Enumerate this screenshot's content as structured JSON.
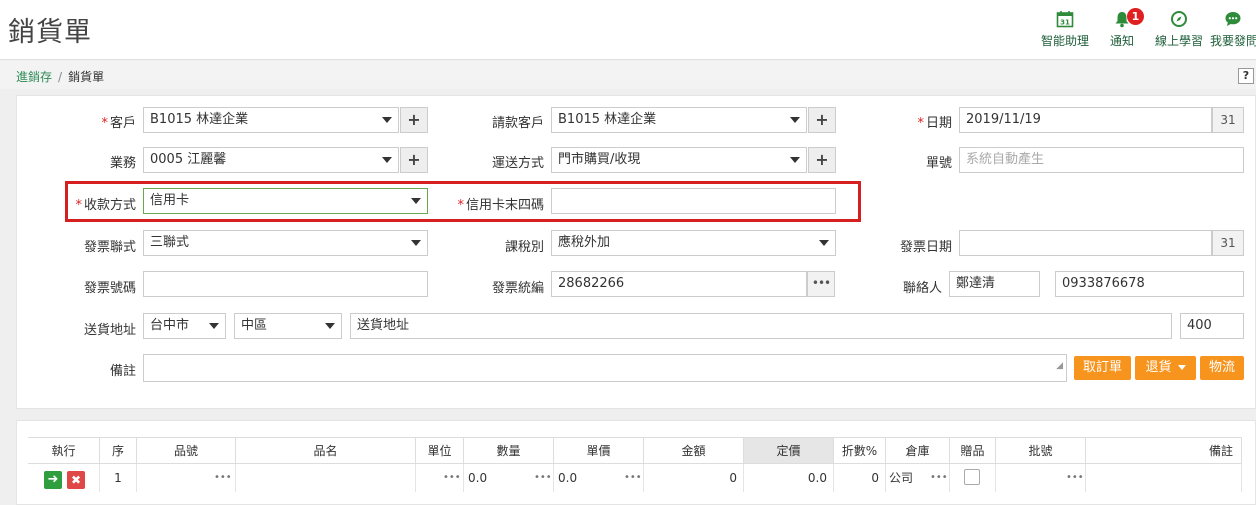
{
  "page": {
    "title": "銷貨單"
  },
  "toolbar": {
    "items": [
      {
        "label": "智能助理",
        "icon": "calendar-31-icon",
        "glyph": "31"
      },
      {
        "label": "通知",
        "icon": "bell-icon",
        "glyph": "🔔",
        "badge": "1"
      },
      {
        "label": "線上學習",
        "icon": "compass-icon",
        "glyph": "⊘"
      },
      {
        "label": "我要發問",
        "icon": "chat-icon",
        "glyph": "💬"
      }
    ]
  },
  "breadcrumb": {
    "parent": "進銷存",
    "separator": "/",
    "current": "銷貨單",
    "help": "?"
  },
  "form": {
    "customer": {
      "label": "客戶",
      "value": "B1015 林達企業"
    },
    "billing_customer": {
      "label": "請款客戶",
      "value": "B1015 林達企業"
    },
    "date": {
      "label": "日期",
      "value": "2019/11/19"
    },
    "salesperson": {
      "label": "業務",
      "value": "0005 江麗馨"
    },
    "delivery_method": {
      "label": "運送方式",
      "value": "門市購買/收現"
    },
    "doc_no": {
      "label": "單號",
      "placeholder": "系統自動產生"
    },
    "payment_method": {
      "label": "收款方式",
      "value": "信用卡"
    },
    "card_last4": {
      "label": "信用卡末四碼",
      "value": ""
    },
    "invoice_copies": {
      "label": "發票聯式",
      "value": "三聯式"
    },
    "tax_type": {
      "label": "課稅別",
      "value": "應稅外加"
    },
    "invoice_date": {
      "label": "發票日期",
      "value": ""
    },
    "invoice_no": {
      "label": "發票號碼",
      "value": ""
    },
    "tax_id": {
      "label": "發票統編",
      "value": "28682266"
    },
    "contact": {
      "label": "聯絡人",
      "name": "鄭達清",
      "phone": "0933876678"
    },
    "address": {
      "label": "送貨地址",
      "city": "台中市",
      "district": "中區",
      "placeholder": "送貨地址",
      "zip": "400"
    },
    "note": {
      "label": "備註",
      "value": ""
    },
    "add_glyph": "+",
    "calendar_glyph": "31",
    "dots_glyph": "•••"
  },
  "actions": {
    "order": "取訂單",
    "returns": "退貨",
    "logistics": "物流"
  },
  "grid": {
    "columns": [
      "執行",
      "序",
      "品號",
      "品名",
      "單位",
      "數量",
      "單價",
      "金額",
      "定價",
      "折數%",
      "倉庫",
      "贈品",
      "批號",
      "備註"
    ],
    "row": {
      "seq": "1",
      "qty": "0.0",
      "price": "0.0",
      "amount": "0",
      "list_price": "0.0",
      "discount": "0",
      "warehouse": "公司"
    },
    "go_glyph": "➜",
    "del_glyph": "✖",
    "dots_glyph": "•••"
  }
}
